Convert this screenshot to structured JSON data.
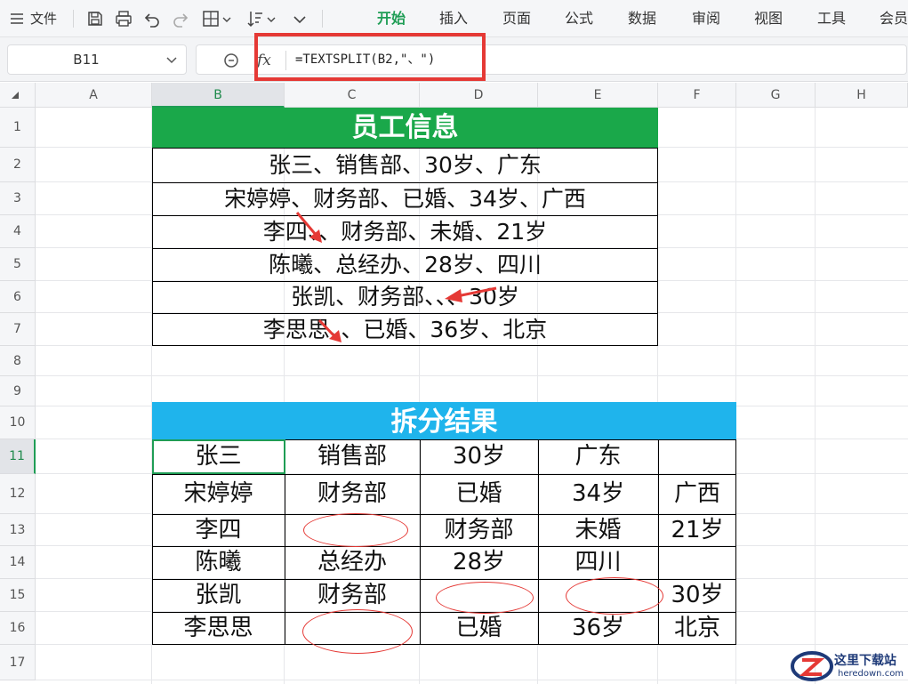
{
  "menubar": {
    "file_label": "文件",
    "tabs": [
      {
        "label": "开始",
        "active": true
      },
      {
        "label": "插入",
        "active": false
      },
      {
        "label": "页面",
        "active": false
      },
      {
        "label": "公式",
        "active": false
      },
      {
        "label": "数据",
        "active": false
      },
      {
        "label": "审阅",
        "active": false
      },
      {
        "label": "视图",
        "active": false
      },
      {
        "label": "工具",
        "active": false
      },
      {
        "label": "会员",
        "active": false
      }
    ],
    "accent_color": "#1f9d55"
  },
  "formula_bar": {
    "name_box": "B11",
    "fx_label": "fx",
    "formula": "=TEXTSPLIT(B2,\"、\")"
  },
  "grid": {
    "columns": [
      "A",
      "B",
      "C",
      "D",
      "E",
      "F",
      "G",
      "H"
    ],
    "rows": [
      "1",
      "2",
      "3",
      "4",
      "5",
      "6",
      "7",
      "8",
      "9",
      "10",
      "11",
      "12",
      "13",
      "14",
      "15",
      "16",
      "17"
    ],
    "selected_column": "B",
    "selected_row": "11"
  },
  "table1": {
    "title": "员工信息",
    "title_color": "#1aa84a",
    "rows": [
      "张三、销售部、30岁、广东",
      "宋婷婷、财务部、已婚、34岁、广西",
      "李四、、财务部、未婚、21岁",
      "陈曦、总经办、28岁、四川",
      "张凯、财务部、、、30岁",
      "李思思、、已婚、36岁、北京"
    ]
  },
  "table2": {
    "title": "拆分结果",
    "title_color": "#1fb4ec",
    "rows": [
      [
        "张三",
        "销售部",
        "30岁",
        "广东",
        ""
      ],
      [
        "宋婷婷",
        "财务部",
        "已婚",
        "34岁",
        "广西"
      ],
      [
        "李四",
        "",
        "财务部",
        "未婚",
        "21岁"
      ],
      [
        "陈曦",
        "总经办",
        "28岁",
        "四川",
        ""
      ],
      [
        "张凯",
        "财务部",
        "",
        "",
        "30岁"
      ],
      [
        "李思思",
        "",
        "已婚",
        "36岁",
        "北京"
      ]
    ]
  },
  "annotations": {
    "highlight_color": "#e53935"
  },
  "watermark": {
    "name": "这里下载站",
    "url": "heredown.com"
  }
}
